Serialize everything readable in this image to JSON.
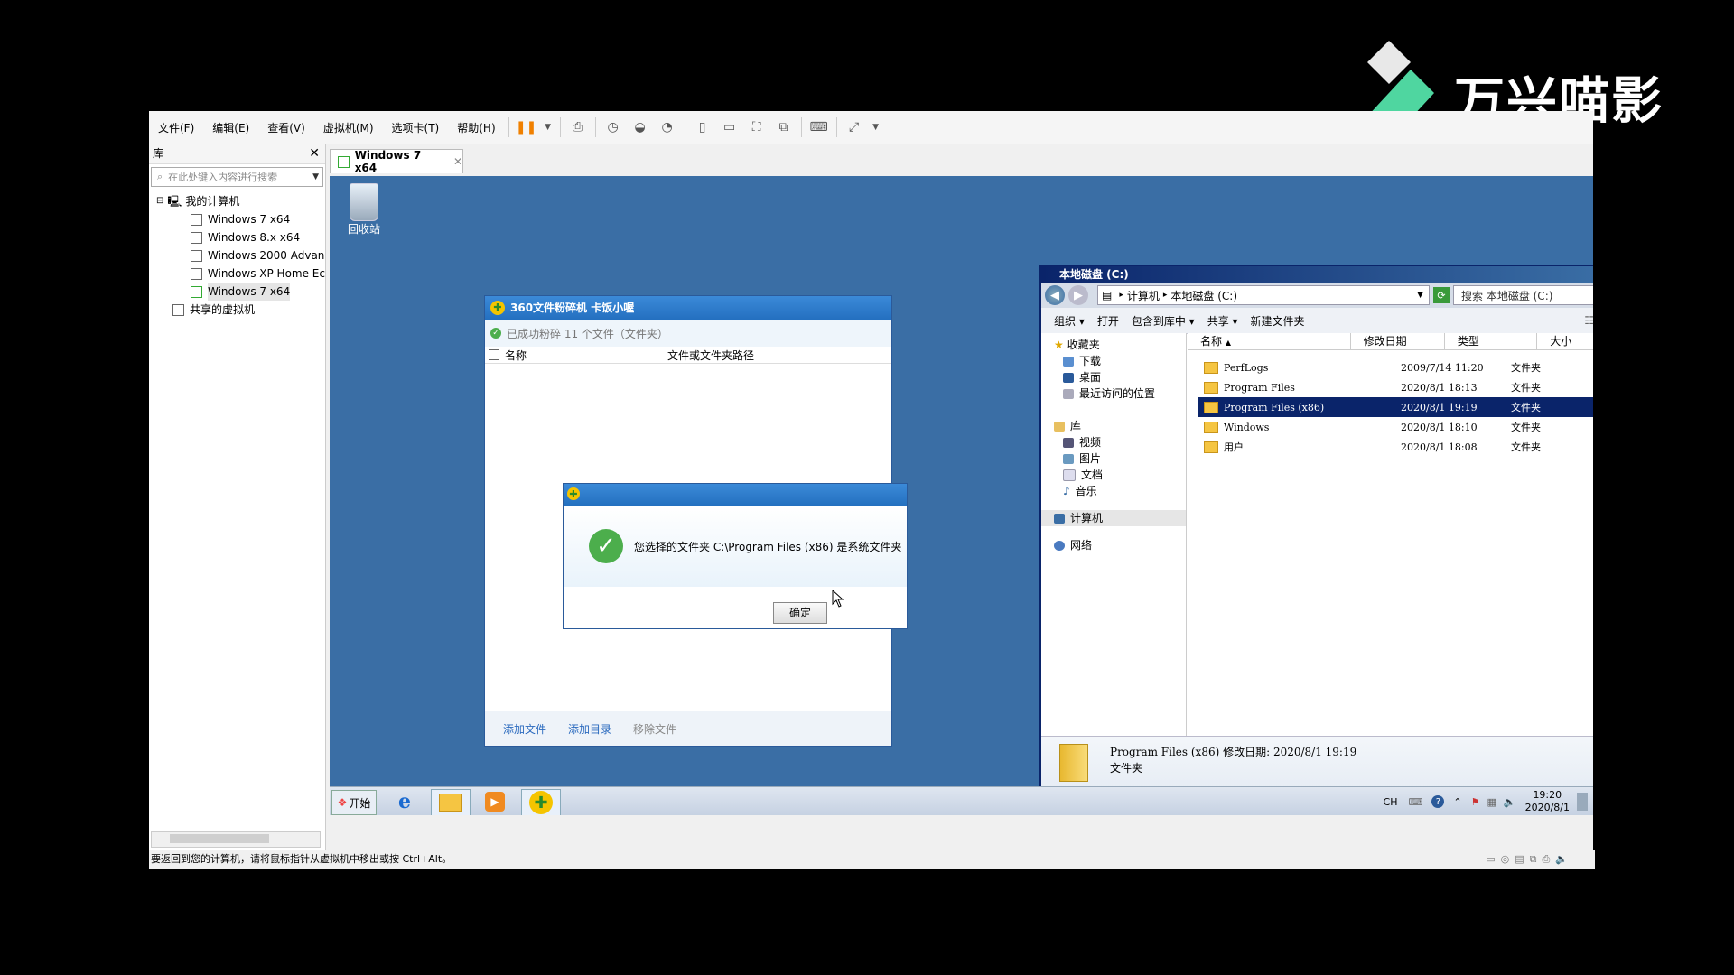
{
  "watermark": {
    "text": "万兴喵影"
  },
  "menu": [
    "文件(F)",
    "编辑(E)",
    "查看(V)",
    "虚拟机(M)",
    "选项卡(T)",
    "帮助(H)"
  ],
  "library": {
    "title": "库",
    "search_placeholder": "在此处键入内容进行搜索",
    "root": "我的计算机",
    "vms": [
      "Windows 7 x64",
      "Windows 8.x x64",
      "Windows 2000 Advan",
      "Windows XP Home Ec",
      "Windows 7 x64"
    ],
    "shared": "共享的虚拟机"
  },
  "tab": {
    "label": "Windows 7 x64"
  },
  "desktop": {
    "recycle_bin": "回收站"
  },
  "shredder": {
    "title": "360文件粉碎机  卡饭小喔",
    "status": "已成功粉碎 11 个文件（文件夹）",
    "col_name": "名称",
    "col_path": "文件或文件夹路径",
    "footer": [
      "添加文件",
      "添加目录",
      "移除文件"
    ]
  },
  "dialog": {
    "message": "您选择的文件夹 C:\\Program Files (x86) 是系统文件夹",
    "ok": "确定"
  },
  "explorer": {
    "title": "本地磁盘  (C:)",
    "breadcrumb": [
      "计算机",
      "本地磁盘 (C:)"
    ],
    "search": "搜索 本地磁盘 (C:)",
    "commands": [
      "组织 ▾",
      "打开",
      "包含到库中 ▾",
      "共享 ▾",
      "新建文件夹"
    ],
    "nav": {
      "favorites": "收藏夹",
      "fav_items": [
        "下载",
        "桌面",
        "最近访问的位置"
      ],
      "libraries": "库",
      "lib_items": [
        "视频",
        "图片",
        "文档",
        "音乐"
      ],
      "computer": "计算机",
      "network": "网络"
    },
    "columns": [
      "名称",
      "修改日期",
      "类型",
      "大小"
    ],
    "rows": [
      {
        "name": "PerfLogs",
        "date": "2009/7/14 11:20",
        "type": "文件夹"
      },
      {
        "name": "Program Files",
        "date": "2020/8/1 18:13",
        "type": "文件夹"
      },
      {
        "name": "Program Files (x86)",
        "date": "2020/8/1 19:19",
        "type": "文件夹"
      },
      {
        "name": "Windows",
        "date": "2020/8/1 18:10",
        "type": "文件夹"
      },
      {
        "name": "用户",
        "date": "2020/8/1 18:08",
        "type": "文件夹"
      }
    ],
    "details_line1": "Program Files (x86)  修改日期: 2020/8/1 19:19",
    "details_line2": "文件夹"
  },
  "taskbar": {
    "start": "开始",
    "lang": "CH",
    "time": "19:20",
    "date": "2020/8/1"
  },
  "statusbar": "要返回到您的计算机，请将鼠标指针从虚拟机中移出或按 Ctrl+Alt。"
}
